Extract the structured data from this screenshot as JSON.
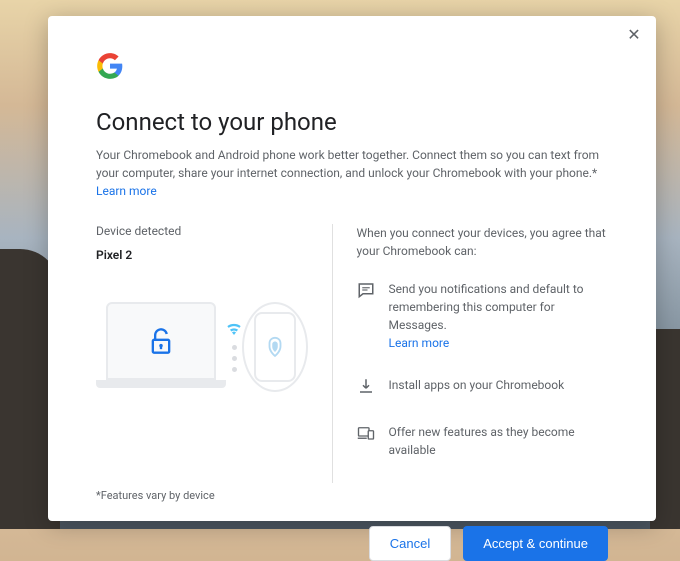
{
  "modal": {
    "title": "Connect to your phone",
    "description": "Your Chromebook and Android phone work better together. Connect them so you can text from your computer, share your internet connection, and unlock your Chromebook with your phone.* ",
    "learn_more": "Learn more"
  },
  "device": {
    "label": "Device detected",
    "name": "Pixel 2"
  },
  "agreement": {
    "intro": "When you connect your devices, you agree that your Chromebook can:",
    "features": [
      {
        "icon": "message",
        "text": "Send you notifications and default to remembering this computer for Messages.",
        "learn_more": "Learn more"
      },
      {
        "icon": "download",
        "text": "Install apps on your Chromebook"
      },
      {
        "icon": "devices",
        "text": "Offer new features as they become available"
      }
    ]
  },
  "footnote": "*Features vary by device",
  "buttons": {
    "cancel": "Cancel",
    "accept": "Accept & continue"
  }
}
